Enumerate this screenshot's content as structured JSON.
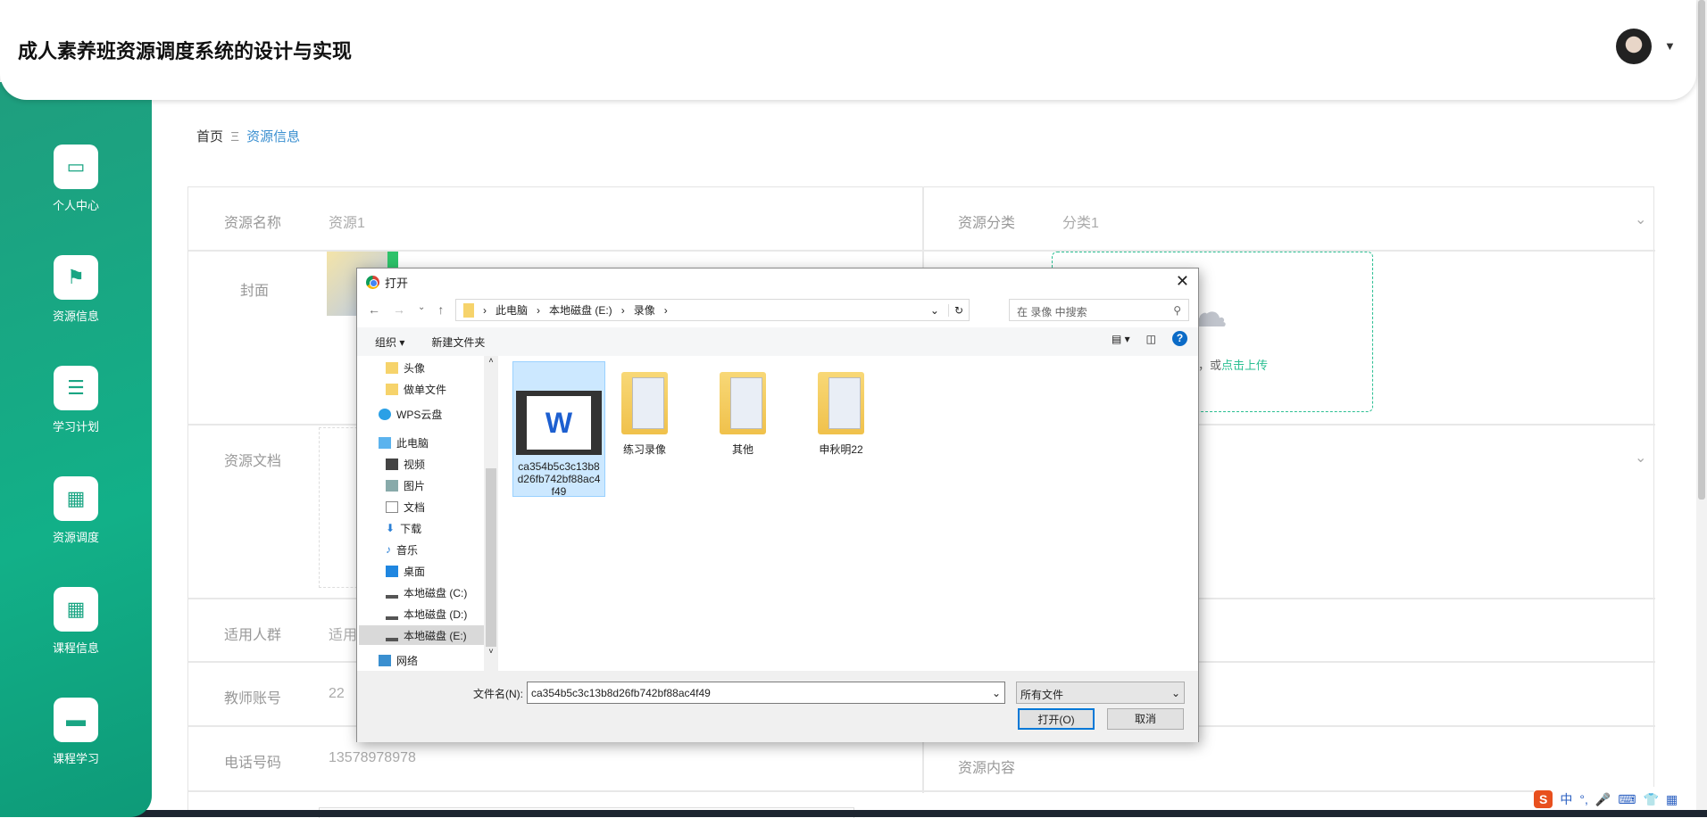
{
  "app": {
    "title": "成人素养班资源调度系统的设计与实现"
  },
  "sidebar": {
    "items": [
      {
        "label": "个人中心",
        "icon": "card-icon"
      },
      {
        "label": "资源信息",
        "icon": "flag-icon"
      },
      {
        "label": "学习计划",
        "icon": "sliders-icon"
      },
      {
        "label": "资源调度",
        "icon": "grid-icon"
      },
      {
        "label": "课程信息",
        "icon": "grid-icon"
      },
      {
        "label": "课程学习",
        "icon": "monitor-icon"
      }
    ]
  },
  "breadcrumb": {
    "home": "首页",
    "sep": "Ξ",
    "current": "资源信息"
  },
  "form": {
    "name_label": "资源名称",
    "name_value": "资源1",
    "category_label": "资源分类",
    "category_value": "分类1",
    "cover_label": "封面",
    "doc_label": "资源文档",
    "audience_label": "适用人群",
    "audience_value": "适用",
    "teacher_label": "教师账号",
    "teacher_value": "22",
    "phone_label": "电话号码",
    "phone_value": "13578978978",
    "content_label": "资源内容",
    "upload_text": "处，或",
    "upload_link": "点击上传"
  },
  "dialog": {
    "title": "打开",
    "path": [
      "此电脑",
      "本地磁盘 (E:)",
      "录像"
    ],
    "search_placeholder": "在 录像 中搜索",
    "organize": "组织 ▾",
    "new_folder": "新建文件夹",
    "nav": [
      "头像",
      "做单文件",
      "WPS云盘",
      "此电脑",
      "视频",
      "图片",
      "文档",
      "下载",
      "音乐",
      "桌面",
      "本地磁盘 (C:)",
      "本地磁盘 (D:)",
      "本地磁盘 (E:)",
      "网络"
    ],
    "files": [
      "ca354b5c3c13b8d26fb742bf88ac4f49",
      "练习录像",
      "其他",
      "申秋明22"
    ],
    "filename_label": "文件名(N):",
    "filename_value": "ca354b5c3c13b8d26fb742bf88ac4f49",
    "filter": "所有文件",
    "open": "打开(O)",
    "cancel": "取消"
  },
  "ime": {
    "items": [
      "中",
      "°,",
      "🎤",
      "⌨",
      "👕",
      "▦"
    ]
  },
  "colors": {
    "accent": "#1aa583",
    "link": "#3a8fd0",
    "upload_link": "#2bbf92"
  }
}
